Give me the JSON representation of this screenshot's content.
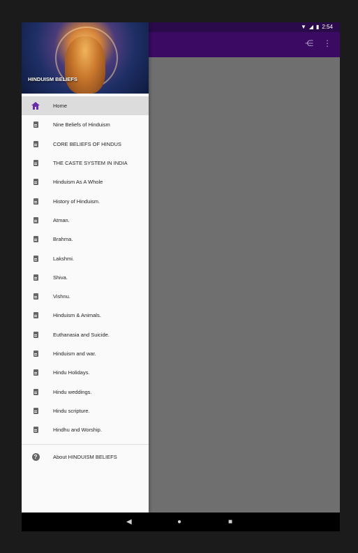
{
  "status_bar": {
    "time": "2:54"
  },
  "drawer": {
    "header_title": "HINDUISM BELIEFS",
    "items": [
      {
        "label": "Home",
        "icon": "home-icon",
        "active": true
      },
      {
        "label": "Nine Beliefs of Hinduism",
        "icon": "document-icon"
      },
      {
        "label": "CORE BELIEFS OF HINDUS",
        "icon": "document-icon"
      },
      {
        "label": "THE CASTE SYSTEM IN INDIA",
        "icon": "document-icon"
      },
      {
        "label": "Hinduism As A Whole",
        "icon": "document-icon"
      },
      {
        "label": "History of Hinduism.",
        "icon": "document-icon"
      },
      {
        "label": "Atman.",
        "icon": "document-icon"
      },
      {
        "label": "Brahma.",
        "icon": "document-icon"
      },
      {
        "label": "Lakshmi.",
        "icon": "document-icon"
      },
      {
        "label": "Shiva.",
        "icon": "document-icon"
      },
      {
        "label": "Vishnu.",
        "icon": "document-icon"
      },
      {
        "label": "Hinduism & Animals.",
        "icon": "document-icon"
      },
      {
        "label": "Euthanasia and Suicide.",
        "icon": "document-icon"
      },
      {
        "label": "Hinduism and war.",
        "icon": "document-icon"
      },
      {
        "label": "Hindu Holidays.",
        "icon": "document-icon"
      },
      {
        "label": "Hindu weddings.",
        "icon": "document-icon"
      },
      {
        "label": "Hindu scripture.",
        "icon": "document-icon"
      },
      {
        "label": "Hindhu and Worship.",
        "icon": "document-icon"
      }
    ],
    "about_label": "About HINDUISM BELIEFS"
  },
  "colors": {
    "app_bar": "#3b0a63",
    "accent": "#6a2ca8"
  }
}
